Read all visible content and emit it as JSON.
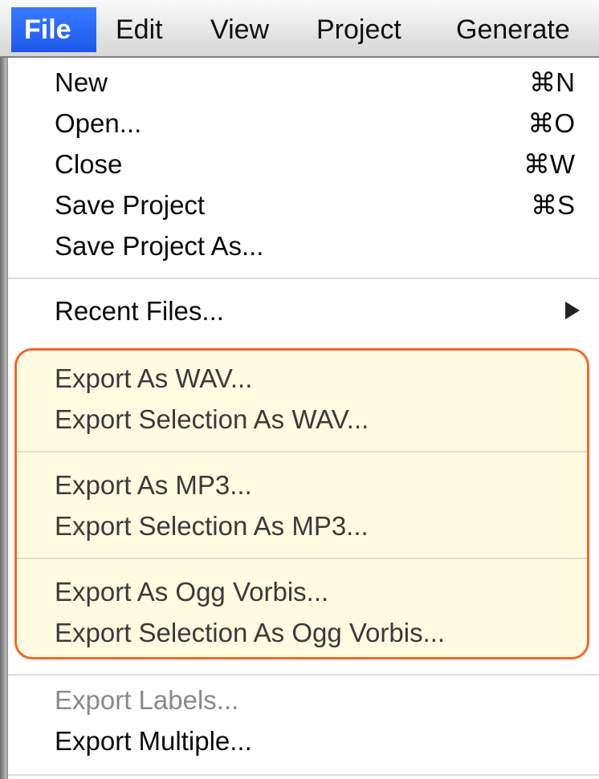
{
  "menubar": {
    "items": [
      {
        "label": "File",
        "active": true
      },
      {
        "label": "Edit"
      },
      {
        "label": "View"
      },
      {
        "label": "Project"
      },
      {
        "label": "Generate"
      }
    ]
  },
  "file_menu": {
    "group1": [
      {
        "label": "New",
        "shortcut": "⌘N"
      },
      {
        "label": "Open...",
        "shortcut": "⌘O"
      },
      {
        "label": "Close",
        "shortcut": "⌘W"
      },
      {
        "label": "Save Project",
        "shortcut": "⌘S"
      },
      {
        "label": "Save Project As..."
      }
    ],
    "recent": {
      "label": "Recent Files...",
      "icon": "submenu-arrow-icon"
    },
    "export_wav": [
      {
        "label": "Export As WAV..."
      },
      {
        "label": "Export Selection As WAV..."
      }
    ],
    "export_mp3": [
      {
        "label": "Export As MP3..."
      },
      {
        "label": "Export Selection As MP3..."
      }
    ],
    "export_ogg": [
      {
        "label": "Export As Ogg Vorbis..."
      },
      {
        "label": "Export Selection As Ogg Vorbis..."
      }
    ],
    "group_last": [
      {
        "label": "Export Labels...",
        "disabled": true
      },
      {
        "label": "Export Multiple..."
      }
    ]
  },
  "colors": {
    "menubar_active": "#1c58e8",
    "highlight_border": "#ee6a2b",
    "highlight_fill": "#fffad7"
  }
}
